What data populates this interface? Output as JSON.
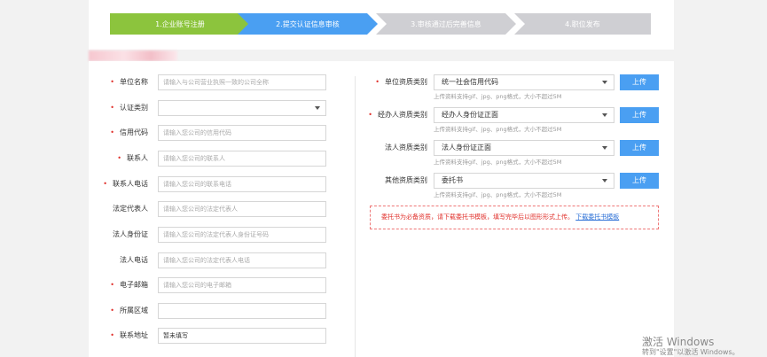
{
  "steps": [
    {
      "label": "1.企业账号注册",
      "state": "done"
    },
    {
      "label": "2.提交认证信息审核",
      "state": "active"
    },
    {
      "label": "3.审核通过后完善信息",
      "state": "pending"
    },
    {
      "label": "4.职位发布",
      "state": "pending"
    }
  ],
  "form_left": {
    "company_name": {
      "label": "单位名称",
      "required": true,
      "placeholder": "请输入与公司营业执照一致的公司全称",
      "value": ""
    },
    "cert_type": {
      "label": "认证类别",
      "required": true,
      "value": ""
    },
    "credit_code": {
      "label": "信用代码",
      "required": true,
      "placeholder": "请输入您公司的信用代码",
      "value": ""
    },
    "contact": {
      "label": "联系人",
      "required": true,
      "placeholder": "请输入您公司的联系人",
      "value": ""
    },
    "contact_phone": {
      "label": "联系人电话",
      "required": true,
      "placeholder": "请输入您公司的联系电话",
      "value": ""
    },
    "legal_rep": {
      "label": "法定代表人",
      "required": false,
      "placeholder": "请输入您公司的法定代表人",
      "value": ""
    },
    "legal_id": {
      "label": "法人身份证",
      "required": false,
      "placeholder": "请输入您公司的法定代表人身份证号码",
      "value": ""
    },
    "legal_phone": {
      "label": "法人电话",
      "required": false,
      "placeholder": "请输入您公司的法定代表人电话",
      "value": ""
    },
    "email": {
      "label": "电子邮箱",
      "required": true,
      "placeholder": "请输入您公司的电子邮箱",
      "value": ""
    },
    "region": {
      "label": "所属区域",
      "required": true,
      "value": ""
    },
    "address": {
      "label": "联系地址",
      "required": true,
      "value": "暂未填写"
    }
  },
  "form_right": {
    "unit_doc": {
      "label": "单位资质类别",
      "required": true,
      "selected": "统一社会信用代码",
      "hint": "上传资料支持gif、jpg、png格式，大小不超过5M",
      "upload_label": "上传"
    },
    "agent_doc": {
      "label": "经办人资质类别",
      "required": true,
      "selected": "经办人身份证正面",
      "hint": "上传资料支持gif、jpg、png格式，大小不超过5M",
      "upload_label": "上传"
    },
    "legal_doc": {
      "label": "法人资质类别",
      "required": false,
      "selected": "法人身份证正面",
      "hint": "上传资料支持gif、jpg、png格式，大小不超过5M",
      "upload_label": "上传"
    },
    "other_doc": {
      "label": "其他资质类别",
      "required": false,
      "selected": "委托书",
      "hint": "上传资料支持gif、jpg、png格式，大小不超过5M",
      "upload_label": "上传"
    }
  },
  "notice": {
    "text": "委托书为必备资质，请下载委托书模板，填写完毕后以图形形式上传。",
    "link": "下载委托书模板"
  },
  "watermark": {
    "title": "激活 Windows",
    "subtitle": "转到\"设置\"以激活 Windows。"
  },
  "colors": {
    "step_done": "#8cc43d",
    "step_active": "#4a9ff2",
    "step_pending": "#cfcfd3",
    "upload_button": "#4a9ff2",
    "required_mark": "#e0302b"
  }
}
